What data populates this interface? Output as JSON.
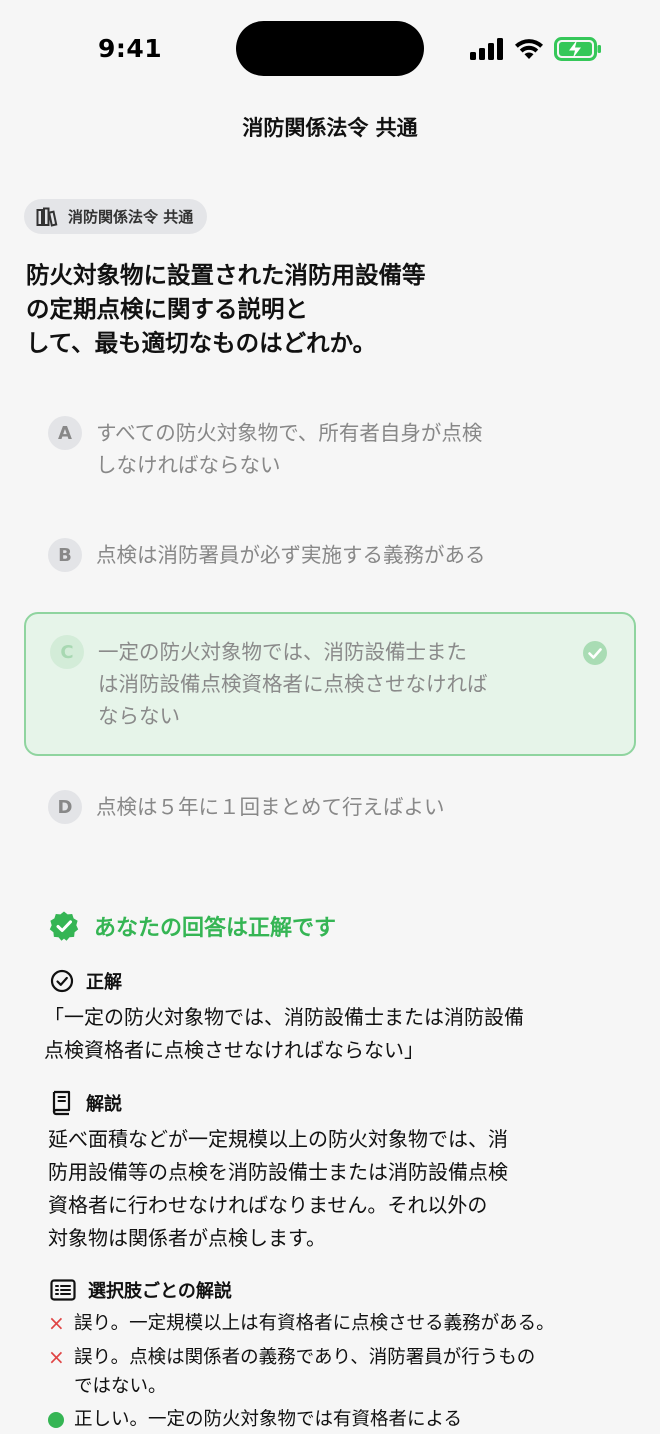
{
  "status_bar": {
    "time": "9:41"
  },
  "nav": {
    "title": "消防関係法令 共通"
  },
  "tag": {
    "label": "消防関係法令 共通"
  },
  "question": {
    "lines": [
      "防火対象物に設置された消防用設備等",
      "の定期点検に関する説明と",
      "して、最も適切なものはどれか。"
    ]
  },
  "choices": [
    {
      "letter": "A",
      "lines": [
        "すべての防火対象物で、所有者自身が点検",
        "しなければならない"
      ]
    },
    {
      "letter": "B",
      "lines": [
        "点検は消防署員が必ず実施する義務がある"
      ]
    },
    {
      "letter": "C",
      "lines": [
        "一定の防火対象物では、消防設備士また",
        "は消防設備点検資格者に点検させなければ",
        "ならない"
      ]
    },
    {
      "letter": "D",
      "lines": [
        "点検は５年に１回まとめて行えばよい"
      ]
    }
  ],
  "result": {
    "text": "あなたの回答は正解です"
  },
  "answer_section": {
    "title": "正解",
    "lines": [
      "「一定の防火対象物では、消防設備士または消防設備",
      "点検資格者に点検させなければならない」"
    ]
  },
  "explanation_section": {
    "title": "解説",
    "lines": [
      "延べ面積などが一定規模以上の防火対象物では、消",
      "防用設備等の点検を消防設備士または消防設備点検",
      "資格者に行わせなければなりません。それ以外の",
      "対象物は関係者が点検します。"
    ]
  },
  "per_choice_section": {
    "title": "選択肢ごとの解説",
    "items": [
      {
        "mark": "×",
        "lines": [
          "誤り。一定規模以上は有資格者に点検させる義務がある。"
        ]
      },
      {
        "mark": "×",
        "lines": [
          "誤り。点検は関係者の義務であり、消防署員が行うもの",
          "ではない。"
        ]
      },
      {
        "mark": "●",
        "lines": [
          "正しい。一定の防火対象物では有資格者による"
        ]
      }
    ]
  },
  "colors": {
    "accent_green": "#35b554",
    "error_red": "#e04444",
    "background": "#f6f6f6"
  }
}
